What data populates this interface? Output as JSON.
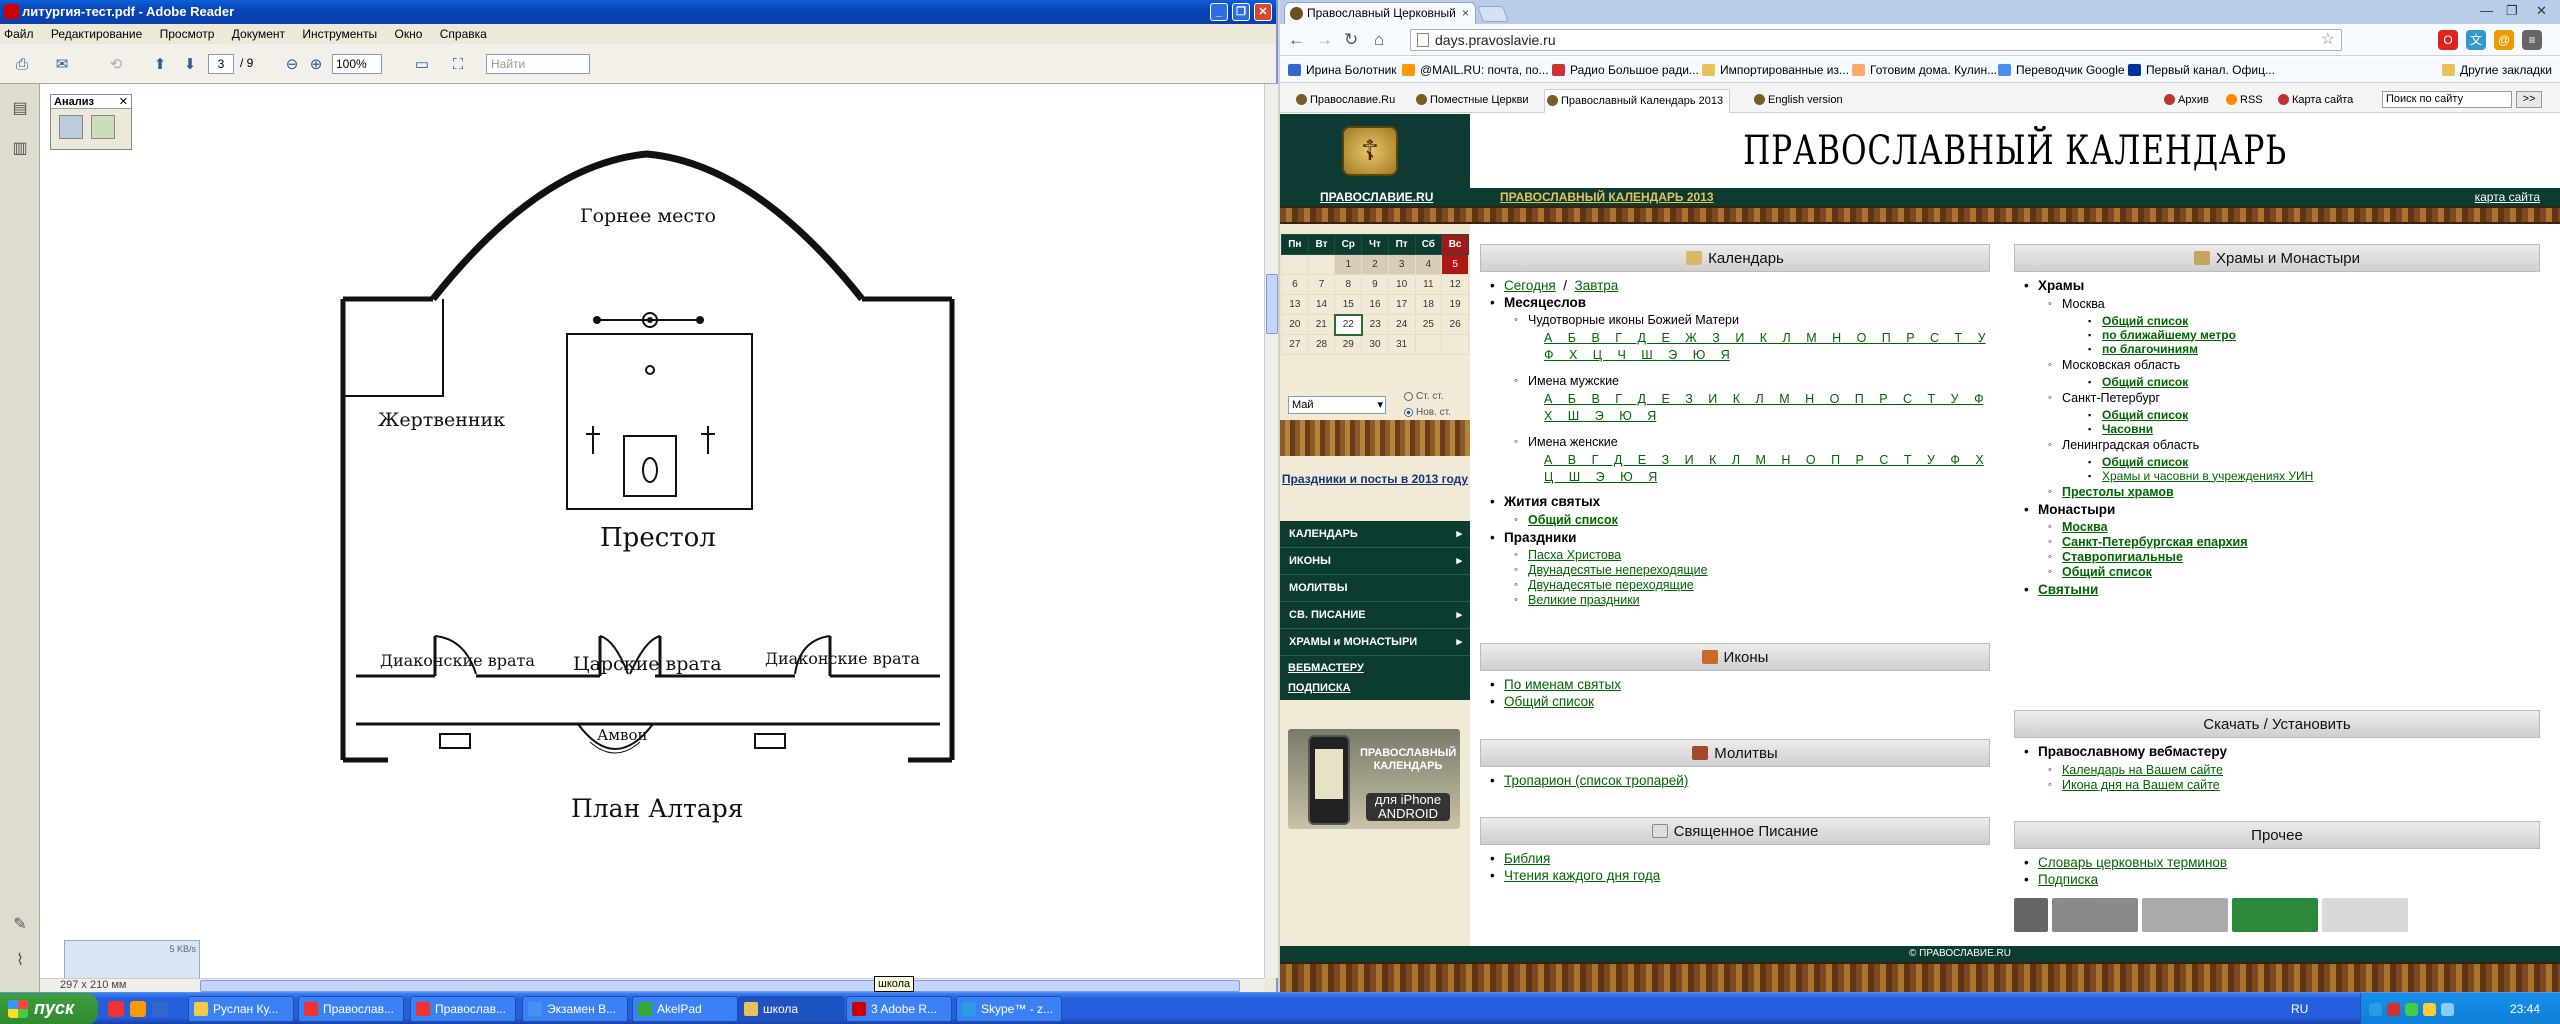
{
  "reader": {
    "title": "литургия-тест.pdf - Adobe Reader",
    "menu": [
      "Файл",
      "Редактирование",
      "Просмотр",
      "Документ",
      "Инструменты",
      "Окно",
      "Справка"
    ],
    "page": "3",
    "pages": "/ 9",
    "zoom": "100%",
    "find_placeholder": "Найти",
    "analysis_panel": "Анализ",
    "page_size": "297 x 210 мм",
    "tip_size": "5 KB/s"
  },
  "drawing": {
    "gornee": "Горнее место",
    "zhertvennik": "Жертвенник",
    "prestol": "Престол",
    "diakon_left": "Диаконские врата",
    "tsarskie": "Царские врата",
    "diakon_right": "Диаконские врата",
    "amvon": "Амвон",
    "plan": "План Алтаря"
  },
  "chrome": {
    "tab_title": "Православный Церковный",
    "url": "days.pravoslavie.ru",
    "bookmarks": [
      "Ирина Болотник",
      "@MAIL.RU: почта, по...",
      "Радио Большое ради...",
      "Импортированные из...",
      "Готовим дома. Кулин...",
      "Переводчик Google",
      "Первый канал. Офиц..."
    ],
    "other_bookmarks": "Другие закладки"
  },
  "site": {
    "tabs": [
      "Православие.Ru",
      "Поместные Церкви",
      "Православный Календарь 2013",
      "English version"
    ],
    "right_links": [
      "Архив",
      "RSS",
      "Карта сайта"
    ],
    "search_placeholder": "Поиск по сайту",
    "search_btn": ">>",
    "title": "ПРАВОСЛАВНЫЙ КАЛЕНДАРЬ",
    "green_left": "ПРАВОСЛАВИЕ.RU",
    "green_mid": "ПРАВОСЛАВНЫЙ КАЛЕНДАРЬ 2013",
    "green_right": "карта сайта",
    "calendar": {
      "days": [
        "Пн",
        "Вт",
        "Ср",
        "Чт",
        "Пт",
        "Сб",
        "Вс"
      ],
      "rows": [
        [
          "",
          "",
          "1",
          "2",
          "3",
          "4",
          "5"
        ],
        [
          "6",
          "7",
          "8",
          "9",
          "10",
          "11",
          "12"
        ],
        [
          "13",
          "14",
          "15",
          "16",
          "17",
          "18",
          "19"
        ],
        [
          "20",
          "21",
          "22",
          "23",
          "24",
          "25",
          "26"
        ],
        [
          "27",
          "28",
          "29",
          "30",
          "31",
          "",
          ""
        ]
      ],
      "month": "Май",
      "old_style": "Ст. ст.",
      "new_style": "Нов. ст."
    },
    "holidays_link": "Праздники и посты в 2013 году",
    "menu": [
      "КАЛЕНДАРЬ",
      "ИКОНЫ",
      "МОЛИТВЫ",
      "СВ. ПИСАНИЕ",
      "ХРАМЫ и МОНАСТЫРИ"
    ],
    "webmaster": "ВЕБМАСТЕРУ",
    "subscribe": "ПОДПИСКА",
    "promo": "ПРАВОСЛАВНЫЙ КАЛЕНДАРЬ",
    "promo2": "для iPhone ANDROID",
    "cal_section": {
      "title": "Календарь",
      "today": "Сегодня",
      "slash": "/",
      "tomorrow": "Завтра",
      "menologion": "Месяцеслов",
      "icons_of": "Чудотворные иконы Божией Матери",
      "letters1": "А Б В Г Д Е Ж З И К Л М Н О П Р С Т У Ф Х Ц Ч Ш Э Ю Я",
      "names_m": "Имена мужские",
      "letters2": "А Б В Г Д Е З И К Л М Н О П Р С Т У Ф Х Ш Э Ю Я",
      "names_f": "Имена женские",
      "letters3": "А В Г Д Е З И К Л М Н О П Р С Т У Ф Х Ц Ш Э Ю Я",
      "lives": "Жития святых",
      "lives_all": "Общий список",
      "feasts": "Праздники",
      "easter": "Пасха Христова",
      "twelve_fixed": "Двунадесятые непереходящие",
      "twelve_moving": "Двунадесятые переходящие",
      "great": "Великие праздники"
    },
    "icons_section": {
      "title": "Иконы",
      "by_names": "По именам святых",
      "all": "Общий список"
    },
    "prayers_section": {
      "title": "Молитвы",
      "troparion": "Тропарион (список тропарей)"
    },
    "scripture_section": {
      "title": "Священное Писание",
      "bible": "Библия",
      "readings": "Чтения каждого дня года"
    },
    "temples_section": {
      "title": "Храмы и Монастыри",
      "temples": "Храмы",
      "moscow": "Москва",
      "m1": "Общий список",
      "m2": "по ближайшему метро",
      "m3": "по благочиниям",
      "mo": "Московская область",
      "mo1": "Общий список",
      "spb": "Санкт-Петербург",
      "spb1": "Общий список",
      "spb2": "Часовни",
      "lo": "Ленинградская область",
      "lo1": "Общий список",
      "lo2": "Храмы и часовни в учреждениях УИН",
      "thrones": "Престолы храмов",
      "monasteries": "Монастыри",
      "mon1": "Москва",
      "mon2": "Санкт-Петербургская епархия",
      "mon3": "Ставропигиальные",
      "mon4": "Общий список",
      "shrines": "Святыни"
    },
    "download_section": {
      "title": "Скачать / Установить",
      "to_webmaster": "Православному вебмастеру",
      "cal_site": "Календарь на Вашем сайте",
      "icon_site": "Икона дня на Вашем сайте"
    },
    "other_section": {
      "title": "Прочее",
      "dictionary": "Словарь церковных терминов",
      "subscription": "Подписка"
    },
    "footer": "© ПРАВОСЛАВИЕ.RU"
  },
  "taskbar": {
    "start": "пуск",
    "tasks": [
      "Руслан Ку...",
      "Православ...",
      "Православ...",
      "Экзамен В...",
      "AkelPad",
      "школа",
      "3 Adobe R...",
      "Skype™ - z..."
    ],
    "lang": "RU",
    "clock": "23:44",
    "tooltip": "школа"
  }
}
